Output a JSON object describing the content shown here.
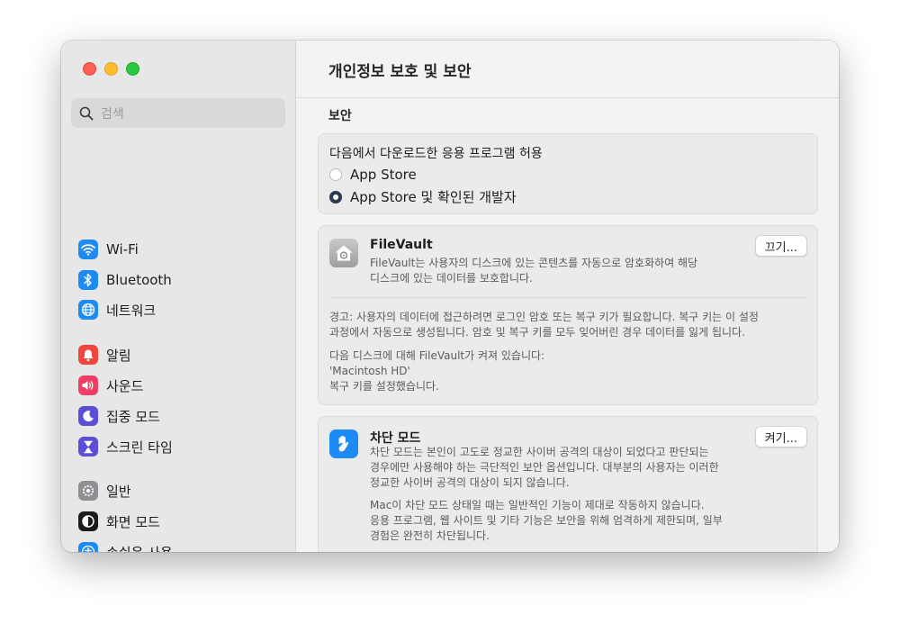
{
  "window": {
    "title": "개인정보 보호 및 보안"
  },
  "search": {
    "placeholder": "검색"
  },
  "sidebar": {
    "items": [
      {
        "label": "Wi-Fi",
        "icon": "wifi-icon",
        "color": "#1e8bf5"
      },
      {
        "label": "Bluetooth",
        "icon": "bluetooth-icon",
        "color": "#1e8bf5"
      },
      {
        "label": "네트워크",
        "icon": "globe-icon",
        "color": "#1e8bf5"
      },
      {
        "label": "알림",
        "icon": "bell-icon",
        "color": "#f0463d"
      },
      {
        "label": "사운드",
        "icon": "speaker-icon",
        "color": "#ef3e66"
      },
      {
        "label": "집중 모드",
        "icon": "moon-icon",
        "color": "#5b4fd6"
      },
      {
        "label": "스크린 타임",
        "icon": "hourglass-icon",
        "color": "#5b4fd6"
      },
      {
        "label": "일반",
        "icon": "gear-icon",
        "color": "#8e8e93"
      },
      {
        "label": "화면 모드",
        "icon": "appearance-icon",
        "color": "#1c1c1e"
      },
      {
        "label": "손쉬운 사용",
        "icon": "accessibility-icon",
        "color": "#1e8bf5"
      }
    ]
  },
  "main": {
    "section_title": "보안",
    "allow_apps": {
      "heading": "다음에서 다운로드한 응용 프로그램 허용",
      "options": [
        {
          "label": "App Store",
          "checked": false
        },
        {
          "label": "App Store 및 확인된 개발자",
          "checked": true
        }
      ]
    },
    "filevault": {
      "title": "FileVault",
      "button": "끄기...",
      "desc_1": "FileVault는 사용자의 디스크에 있는 콘텐츠를 자동으로 암호화하여 해당",
      "desc_2": "디스크에 있는 데이터를 보호합니다.",
      "warning_1": "경고: 사용자의 데이터에 접근하려면 로그인 암호 또는 복구 키가 필요합니다. 복구 키는 이 설정",
      "warning_2": "과정에서 자동으로 생성됩니다. 암호 및 복구 키를 모두 잊어버린 경우 데이터를 잃게 됩니다.",
      "status_1": "다음 디스크에 대해 FileVault가 켜져 있습니다:",
      "status_2": "'Macintosh HD'",
      "status_3": "복구 키를 설정했습니다."
    },
    "lockdown": {
      "title": "차단 모드",
      "button": "켜기...",
      "desc_1": "차단 모드는 본인이 고도로 정교한 사이버 공격의 대상이 되었다고 판단되는",
      "desc_2": "경우에만 사용해야 하는 극단적인 보안 옵션입니다. 대부분의 사용자는 이러한",
      "desc_3": "정교한 사이버 공격의 대상이 되지 않습니다.",
      "desc_4": "Mac이 차단 모드 상태일 때는 일반적인 기능이 제대로 작동하지 않습니다.",
      "desc_5": "응용 프로그램, 웹 사이트 및 기타 기능은 보안을 위해 엄격하게 제한되며, 일부",
      "desc_6": "경험은 완전히 차단됩니다."
    }
  }
}
